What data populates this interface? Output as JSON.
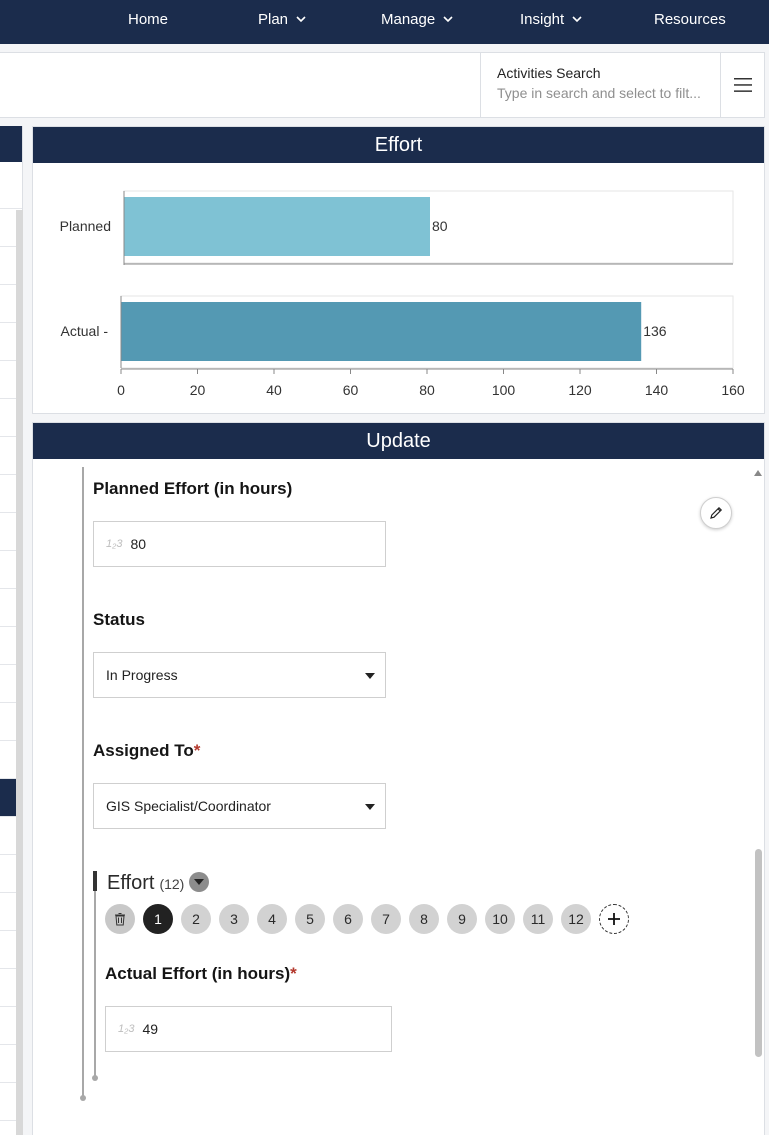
{
  "nav": {
    "home": "Home",
    "plan": "Plan",
    "manage": "Manage",
    "insight": "Insight",
    "resources": "Resources"
  },
  "search": {
    "title": "Activities Search",
    "placeholder": "Type in search and select to filt..."
  },
  "effort_panel": {
    "title": "Effort"
  },
  "chart_data": {
    "type": "bar",
    "orientation": "horizontal",
    "categories": [
      "Planned",
      "Actual -"
    ],
    "values": [
      80,
      136
    ],
    "data_labels": [
      "80",
      "136"
    ],
    "xlim": [
      0,
      160
    ],
    "xticks": [
      "0",
      "20",
      "40",
      "60",
      "80",
      "100",
      "120",
      "140",
      "160"
    ],
    "colors": [
      "#7fc2d4",
      "#5499b3"
    ],
    "grid": false
  },
  "update_panel": {
    "title": "Update",
    "planned_effort_label": "Planned Effort (in hours)",
    "planned_effort_value": "80",
    "status_label": "Status",
    "status_value": "In Progress",
    "assigned_to_label": "Assigned To",
    "assigned_to_required": "*",
    "assigned_to_value": "GIS Specialist/Coordinator",
    "effort_group_title": "Effort",
    "effort_group_count": "(12)",
    "pages": [
      "1",
      "2",
      "3",
      "4",
      "5",
      "6",
      "7",
      "8",
      "9",
      "10",
      "11",
      "12"
    ],
    "active_page": "1",
    "actual_effort_label": "Actual Effort (in hours)",
    "actual_effort_required": "*",
    "actual_effort_value": "49",
    "number_icon_glyph": "1₂3"
  },
  "icons": {
    "menu": "hamburger-icon",
    "edit": "pencil-icon",
    "delete": "trash-icon",
    "add": "plus-icon",
    "nav_dropdown": "chevron-down-icon"
  }
}
